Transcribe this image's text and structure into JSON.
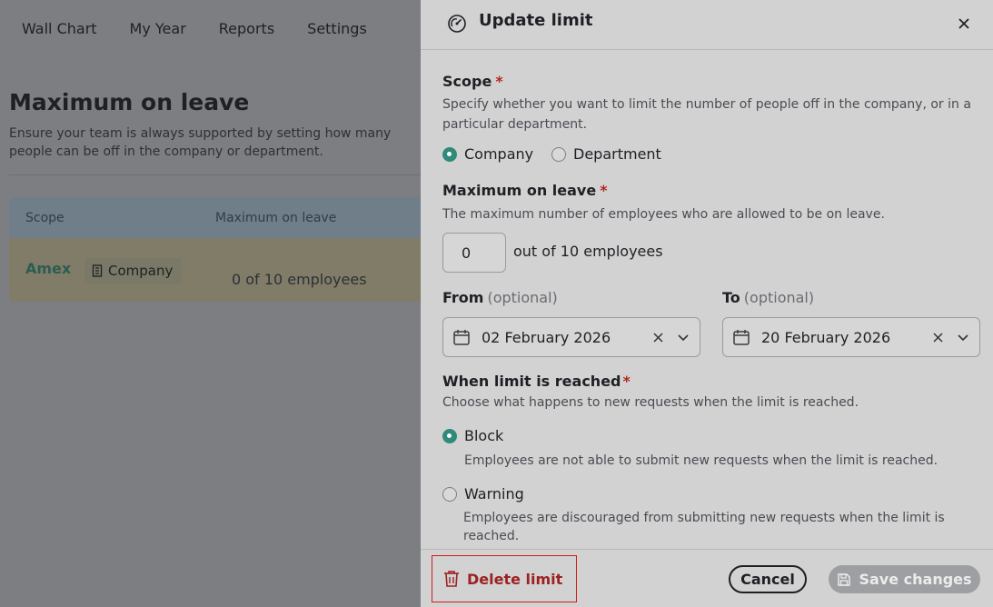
{
  "nav": {
    "items": [
      "Wall Chart",
      "My Year",
      "Reports",
      "Settings"
    ]
  },
  "background": {
    "title": "Maximum on leave",
    "description": "Ensure your team is always supported by setting how many people can be off in the company or department.",
    "table": {
      "headers": [
        "Scope",
        "Maximum on leave"
      ],
      "row": {
        "name": "Amex",
        "scope": "Company",
        "max": "0 of 10 employees"
      }
    }
  },
  "drawer": {
    "title": "Update limit",
    "scope": {
      "label": "Scope",
      "required": "*",
      "help": "Specify whether you want to limit the number of people off in the company, or in a particular department.",
      "options": [
        "Company",
        "Department"
      ],
      "selected": "Company"
    },
    "max": {
      "label": "Maximum on leave",
      "required": "*",
      "help": "The maximum number of employees who are allowed to be on leave.",
      "value": "0",
      "suffix": "out of 10 employees"
    },
    "from": {
      "label": "From",
      "optional": "(optional)",
      "value": "02 February 2026"
    },
    "to": {
      "label": "To",
      "optional": "(optional)",
      "value": "20 February 2026"
    },
    "when": {
      "label": "When limit is reached",
      "required": "*",
      "help": "Choose what happens to new requests when the limit is reached.",
      "options": [
        {
          "label": "Block",
          "description": "Employees are not able to submit new requests when the limit is reached."
        },
        {
          "label": "Warning",
          "description": "Employees are discouraged from submitting new requests when the limit is reached."
        }
      ],
      "selected": "Block"
    },
    "footer": {
      "delete": "Delete limit",
      "cancel": "Cancel",
      "save": "Save changes"
    }
  },
  "colors": {
    "accent": "#2f8a7a",
    "danger": "#d11a1a",
    "danger_text": "#9c2222"
  }
}
